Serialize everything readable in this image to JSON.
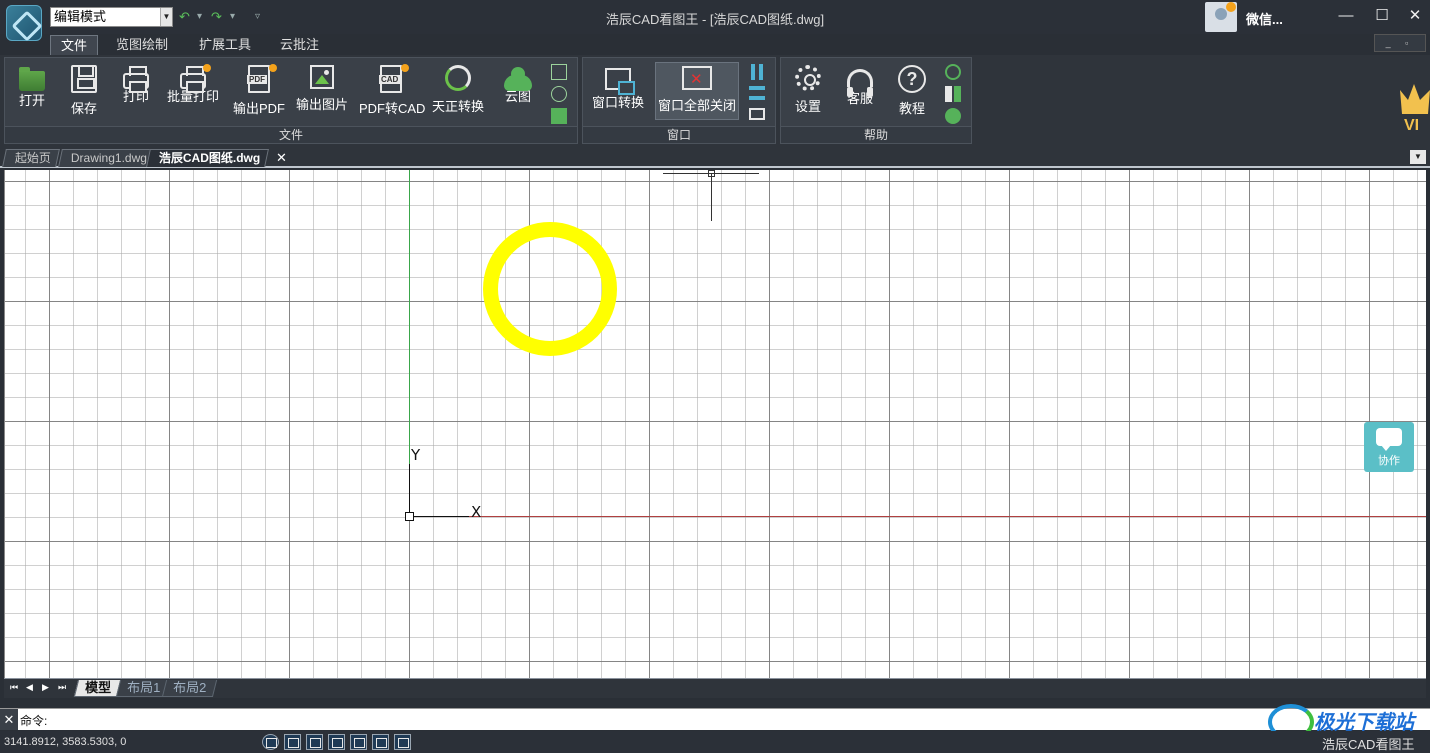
{
  "title_bar": {
    "mode_select_value": "编辑模式",
    "window_title": "浩辰CAD看图王 - [浩辰CAD图纸.dwg]",
    "user_name": "微信...",
    "minimize": "—",
    "maximize": "☐",
    "close": "✕",
    "mdi_controls": "_ ▫ ✕"
  },
  "quick_access": {
    "undo": "↶",
    "undo_menu": "▾",
    "redo": "↷",
    "redo_menu": "▾",
    "customize": "▿"
  },
  "menu_tabs": [
    {
      "label": "文件",
      "active": true
    },
    {
      "label": "览图绘制",
      "active": false
    },
    {
      "label": "扩展工具",
      "active": false
    },
    {
      "label": "云批注",
      "active": false
    }
  ],
  "ribbon": {
    "file_group": {
      "label": "文件",
      "buttons": [
        {
          "label": "打开",
          "icon": "open-folder-icon"
        },
        {
          "label": "保存",
          "icon": "save-disk-icon"
        },
        {
          "label": "打印",
          "icon": "printer-icon"
        },
        {
          "label": "批量打印",
          "icon": "batch-printer-icon"
        },
        {
          "label": "输出PDF",
          "icon": "pdf-export-icon"
        },
        {
          "label": "输出图片",
          "icon": "image-export-icon"
        },
        {
          "label": "PDF转CAD",
          "icon": "pdf-to-cad-icon"
        },
        {
          "label": "天正转换",
          "icon": "tangent-convert-icon"
        },
        {
          "label": "云图",
          "icon": "cloud-icon"
        }
      ],
      "pdf_tag": "PDF",
      "pdf2cad_tag": "CAD"
    },
    "window_group": {
      "label": "窗口",
      "buttons": [
        {
          "label": "窗口转换",
          "icon": "window-switch-icon"
        },
        {
          "label": "窗口全部关闭",
          "icon": "window-close-all-icon"
        }
      ]
    },
    "help_group": {
      "label": "帮助",
      "buttons": [
        {
          "label": "设置",
          "icon": "gear-icon"
        },
        {
          "label": "客服",
          "icon": "headset-icon"
        },
        {
          "label": "教程",
          "icon": "help-icon"
        }
      ],
      "help_glyph": "?"
    },
    "vip_label": "VI"
  },
  "doc_tabs": [
    {
      "label": "起始页",
      "active": false
    },
    {
      "label": "Drawing1.dwg",
      "active": false
    },
    {
      "label": "浩辰CAD图纸.dwg",
      "active": true
    }
  ],
  "doc_tab_close": "✕",
  "doc_tab_dropdown": "▼",
  "canvas": {
    "y_axis_label": "Y",
    "x_axis_label": "X",
    "ring_color": "#ffff00",
    "collab_label": "协作"
  },
  "layout_tabs": [
    {
      "label": "模型",
      "active": true
    },
    {
      "label": "布局1",
      "active": false
    },
    {
      "label": "布局2",
      "active": false
    }
  ],
  "layout_nav": [
    "⏮",
    "◀",
    "▶",
    "⏭"
  ],
  "command": {
    "close": "✕",
    "prompt": "命令:"
  },
  "status": {
    "coordinates": "3141.8912, 3583.5303, 0",
    "watermark": "极光下载站",
    "brand": "浩辰CAD看图王"
  }
}
